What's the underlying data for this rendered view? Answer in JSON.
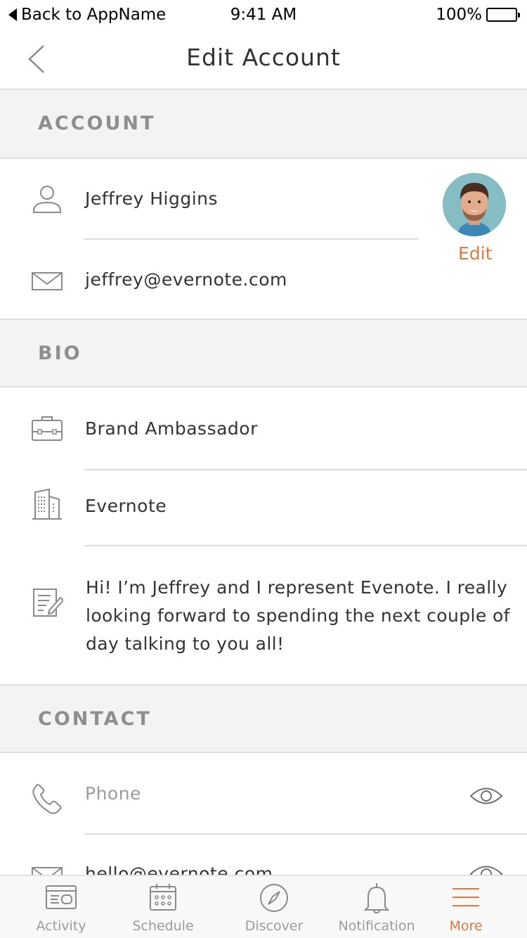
{
  "status_bar": {
    "back_label": "Back to AppName",
    "time": "9:41 AM",
    "battery": "100%"
  },
  "nav": {
    "title": "Edit Account"
  },
  "sections": {
    "account": "ACCOUNT",
    "bio": "BIO",
    "contact": "CONTACT"
  },
  "account": {
    "name": "Jeffrey Higgins",
    "email": "jeffrey@evernote.com",
    "avatar_edit": "Edit"
  },
  "bio": {
    "title": "Brand Ambassador",
    "company": "Evernote",
    "about": "Hi! I’m Jeffrey and I represent Evenote. I really looking forward to spending the next couple of day talking to you all!"
  },
  "contact": {
    "phone_placeholder": "Phone",
    "email": "hello@evernote.com"
  },
  "tabs": [
    {
      "label": "Activity",
      "icon": "activity-icon"
    },
    {
      "label": "Schedule",
      "icon": "calendar-icon"
    },
    {
      "label": "Discover",
      "icon": "compass-icon"
    },
    {
      "label": "Notification",
      "icon": "bell-icon"
    },
    {
      "label": "More",
      "icon": "menu-icon",
      "active": true
    }
  ],
  "colors": {
    "accent": "#e07a3f",
    "section_bg": "#f4f3f3",
    "divider": "#dedede"
  }
}
